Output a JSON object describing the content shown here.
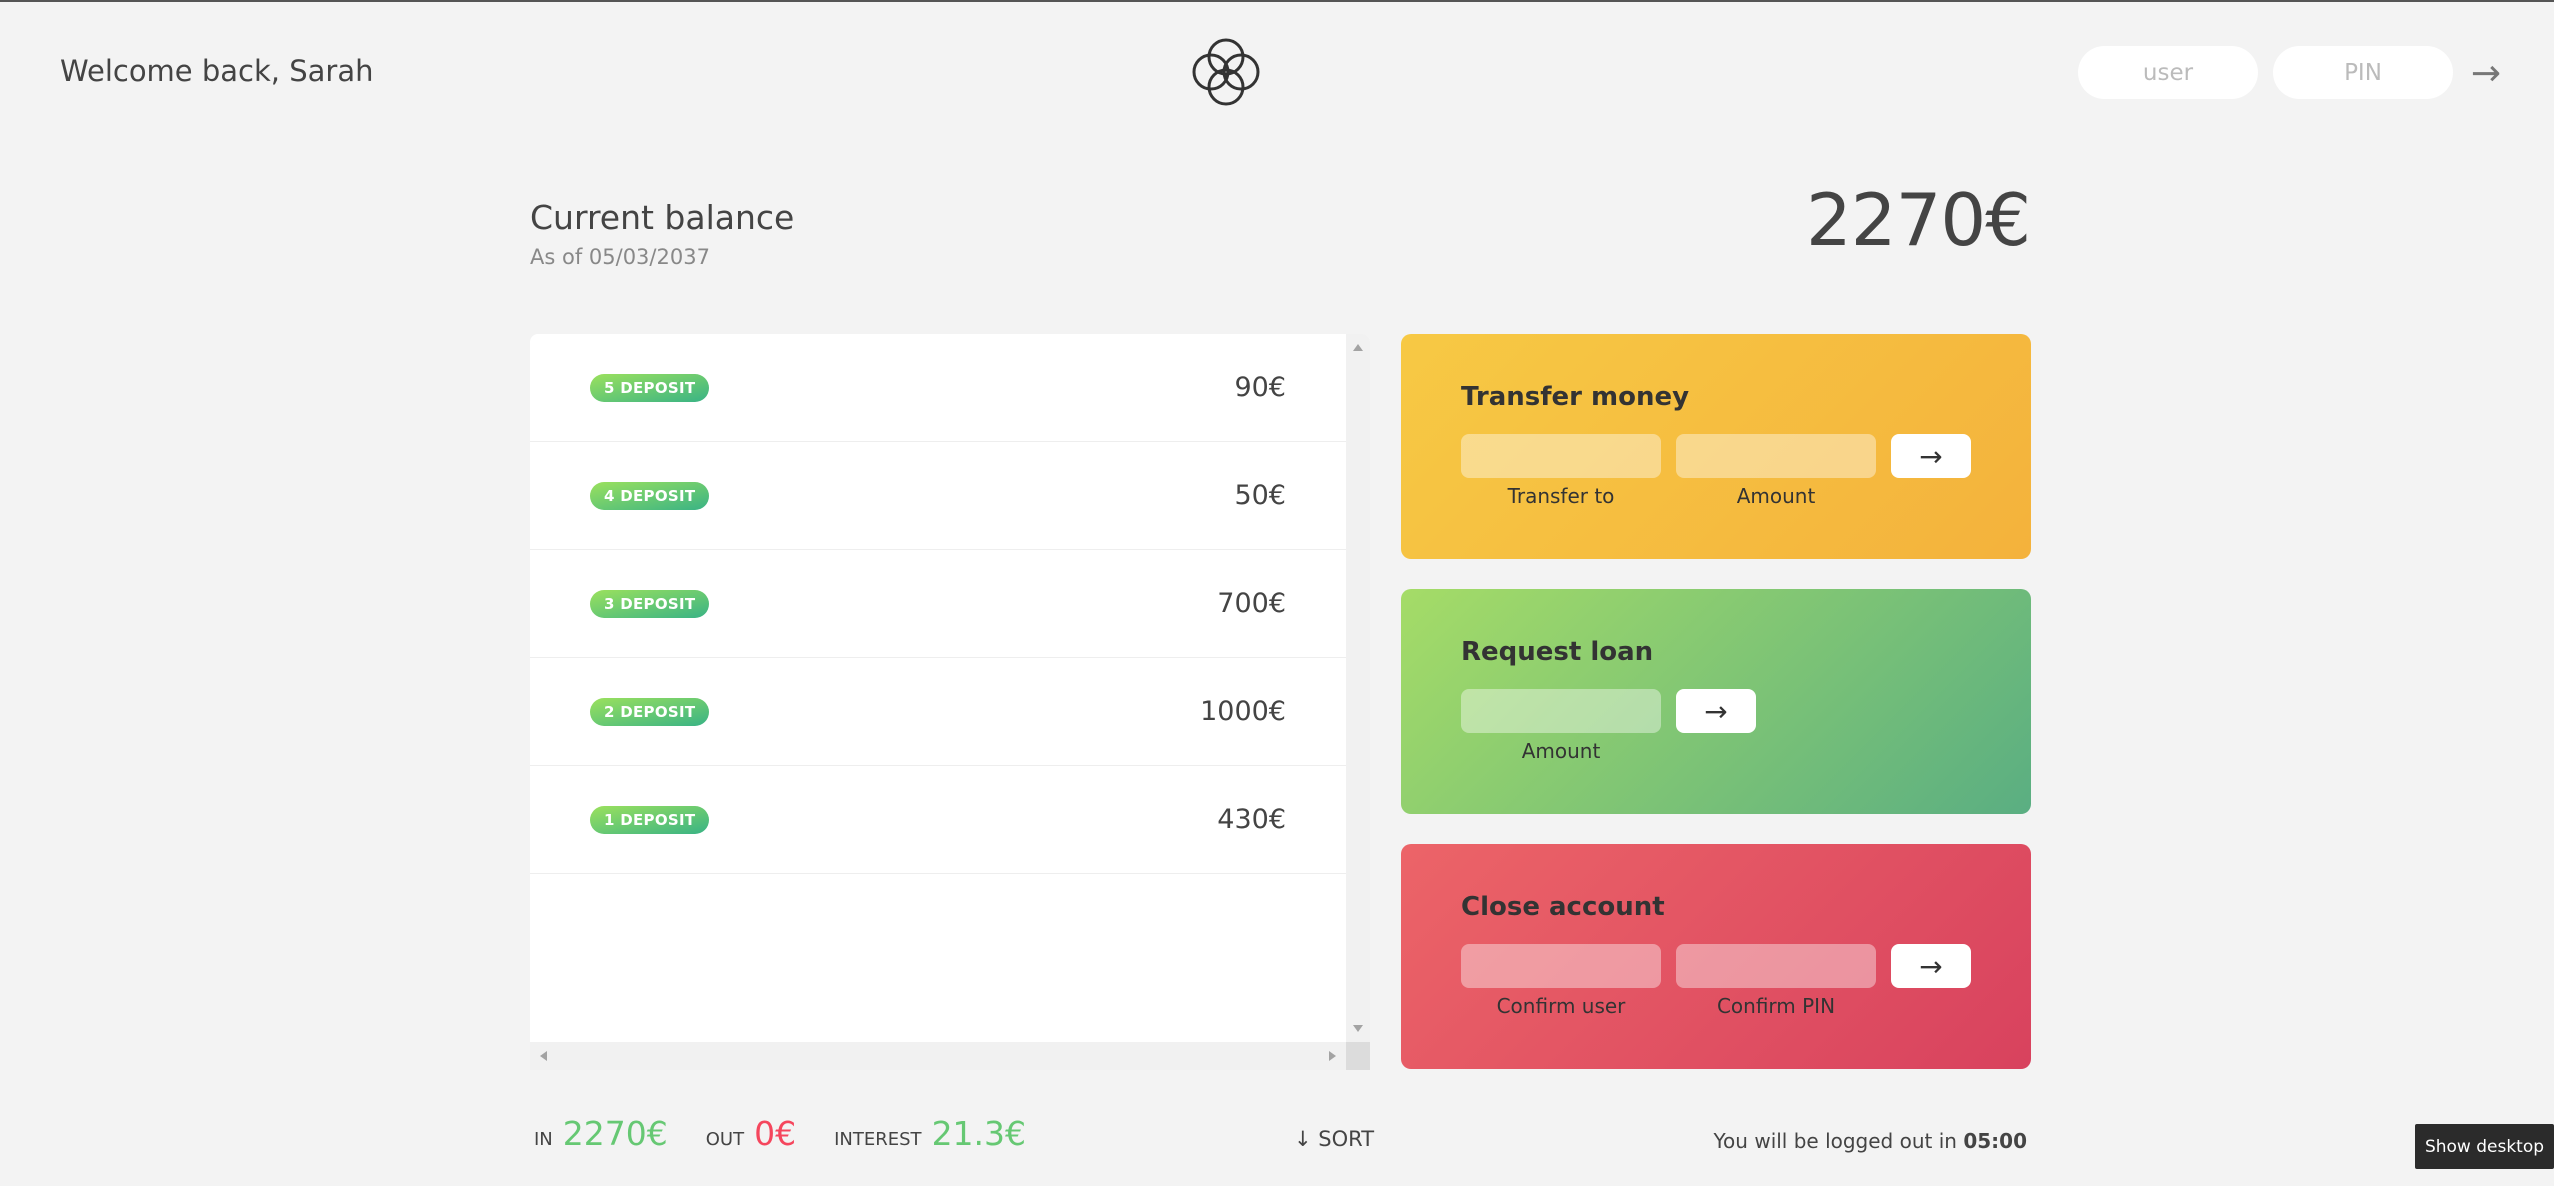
{
  "nav": {
    "welcome": "Welcome back, Sarah",
    "login_user_placeholder": "user",
    "login_pin_placeholder": "PIN",
    "login_button": "→"
  },
  "balance": {
    "label": "Current balance",
    "date": "As of 05/03/2037",
    "value": "2270€"
  },
  "movements": [
    {
      "type": "5 DEPOSIT",
      "value": "90€"
    },
    {
      "type": "4 DEPOSIT",
      "value": "50€"
    },
    {
      "type": "3 DEPOSIT",
      "value": "700€"
    },
    {
      "type": "2 DEPOSIT",
      "value": "1000€"
    },
    {
      "type": "1 DEPOSIT",
      "value": "430€"
    }
  ],
  "operations": {
    "transfer": {
      "title": "Transfer money",
      "label_to": "Transfer to",
      "label_amount": "Amount",
      "button": "→"
    },
    "loan": {
      "title": "Request loan",
      "label_amount": "Amount",
      "button": "→"
    },
    "close": {
      "title": "Close account",
      "label_user": "Confirm user",
      "label_pin": "Confirm PIN",
      "button": "→"
    }
  },
  "summary": {
    "in_label": "In",
    "in_value": "2270€",
    "out_label": "Out",
    "out_value": "0€",
    "interest_label": "Interest",
    "interest_value": "21.3€",
    "sort_label": "↓ SORT"
  },
  "logout": {
    "text": "You will be logged out in ",
    "time": "05:00"
  },
  "taskbar": {
    "show_desktop": "Show desktop"
  },
  "colors": {
    "deposit": "#66c873",
    "withdrawal": "#f5465d",
    "transfer_card": "#f6be41",
    "loan_card": "#84c775",
    "close_card": "#e2505f"
  }
}
